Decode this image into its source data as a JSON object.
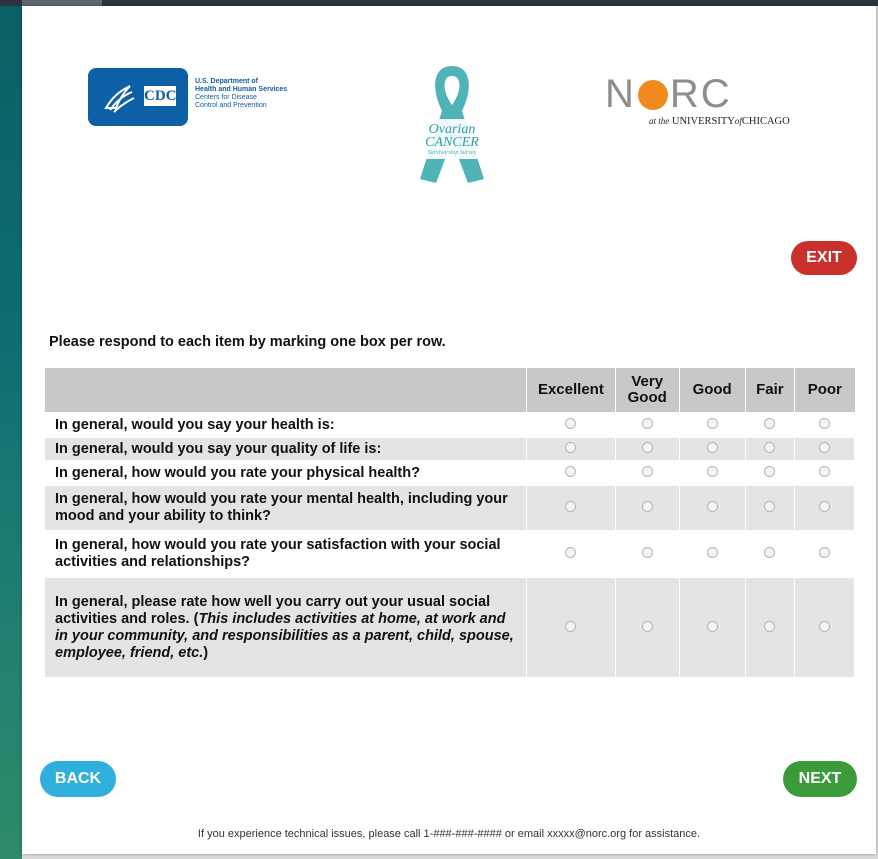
{
  "logos": {
    "cdc_label": "CDC",
    "dept_line1": "U.S. Department of",
    "dept_line2": "Health and Human Services",
    "dept_line3": "Centers for Disease",
    "dept_line4": "Control and Prevention",
    "ribbon_title1": "Ovarian",
    "ribbon_title2": "CANCER",
    "ribbon_subtitle": "Survivorship Survey",
    "norc_n": "N",
    "norc_rc": "RC",
    "norc_sub_at": "at the",
    "norc_sub_uni": "UNIVERSITY",
    "norc_sub_of": "of",
    "norc_sub_chi": "CHICAGO"
  },
  "buttons": {
    "exit": "EXIT",
    "back": "BACK",
    "next": "NEXT"
  },
  "instructions": "Please respond to each item by marking one box per row.",
  "columns": [
    "Excellent",
    "Very Good",
    "Good",
    "Fair",
    "Poor"
  ],
  "col_very": "Very",
  "col_good2": "Good",
  "questions": [
    "In general, would you say your health is:",
    "In general, would you say your quality of life is:",
    "In general, how would you rate your physical health?",
    "In general, how would you rate your mental health, including your mood and your ability to think?",
    "In general, how would you rate your satisfaction with your social activities and relationships?"
  ],
  "q6_plain": "In general, please rate how well you carry out your usual social activities and roles. (",
  "q6_italic": "This includes activities at home, at work and in your community, and responsibilities as a parent, child, spouse, employee, friend, etc.",
  "q6_close": ")",
  "footer": "If you experience technical issues, please call 1-###-###-#### or email xxxxx@norc.org for assistance.",
  "colors": {
    "exit": "#c9302c",
    "back": "#2fb0dc",
    "next": "#3b9b3b",
    "cdc_blue": "#0d5fa6",
    "norc_orange": "#f08a1c"
  }
}
